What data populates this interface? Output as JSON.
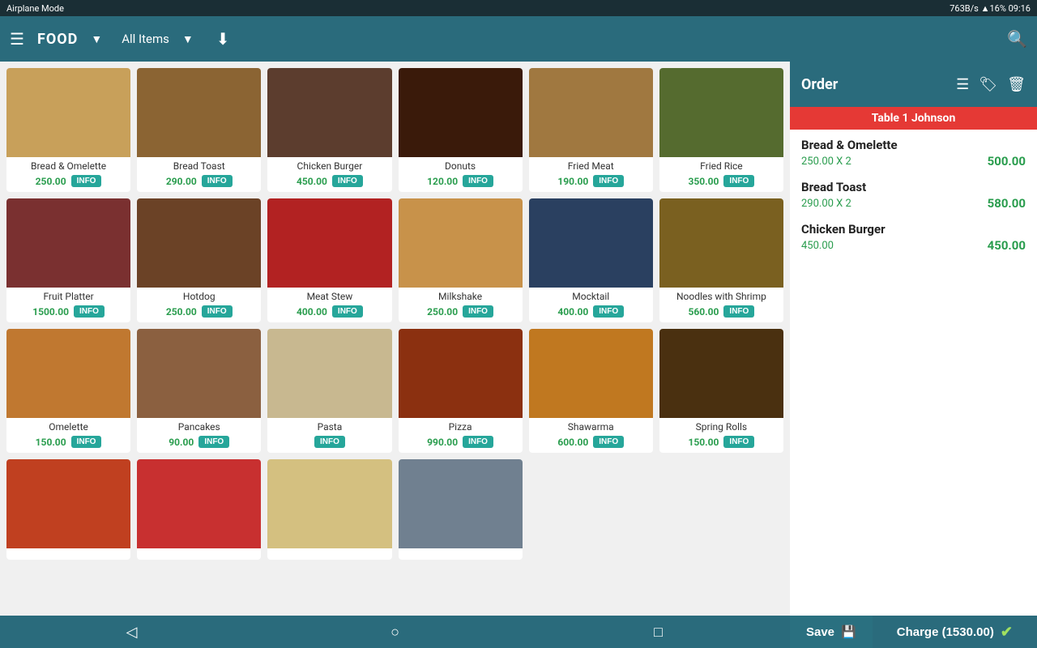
{
  "statusBar": {
    "left": "Airplane Mode",
    "right": "763B/s  ▲16%  09:16"
  },
  "topNav": {
    "menuIcon": "☰",
    "title": "FOOD",
    "dropdownIcon": "▼",
    "category": "All Items",
    "categoryDropIcon": "▼",
    "inboxIcon": "⬇",
    "searchIcon": "🔍"
  },
  "foodItems": [
    {
      "name": "Bread & Omelette",
      "price": "250.00",
      "color": "#c8a05a",
      "id": "bread-omelette"
    },
    {
      "name": "Bread Toast",
      "price": "290.00",
      "color": "#8b6433",
      "id": "bread-toast"
    },
    {
      "name": "Chicken Burger",
      "price": "450.00",
      "color": "#5c3d2e",
      "id": "chicken-burger"
    },
    {
      "name": "Donuts",
      "price": "120.00",
      "color": "#3a1a0a",
      "id": "donuts"
    },
    {
      "name": "Fried Meat",
      "price": "190.00",
      "color": "#a07840",
      "id": "fried-meat"
    },
    {
      "name": "Fried Rice",
      "price": "350.00",
      "color": "#556b2f",
      "id": "fried-rice"
    },
    {
      "name": "Fruit Platter",
      "price": "1500.00",
      "color": "#7a3030",
      "id": "fruit-platter"
    },
    {
      "name": "Hotdog",
      "price": "250.00",
      "color": "#6b4226",
      "id": "hotdog"
    },
    {
      "name": "Meat Stew",
      "price": "400.00",
      "color": "#b22222",
      "id": "meat-stew"
    },
    {
      "name": "Milkshake",
      "price": "250.00",
      "color": "#c8924a",
      "id": "milkshake"
    },
    {
      "name": "Mocktail",
      "price": "400.00",
      "color": "#2a4060",
      "id": "mocktail"
    },
    {
      "name": "Noodles with Shrimp",
      "price": "560.00",
      "color": "#7a6020",
      "id": "noodles-shrimp"
    },
    {
      "name": "Omelette",
      "price": "150.00",
      "color": "#c07830",
      "id": "omelette"
    },
    {
      "name": "Pancakes",
      "price": "90.00",
      "color": "#8b6040",
      "id": "pancakes"
    },
    {
      "name": "Pasta",
      "price": "",
      "color": "#c8b890",
      "id": "pasta"
    },
    {
      "name": "Pizza",
      "price": "990.00",
      "color": "#8b3010",
      "id": "pizza"
    },
    {
      "name": "Shawarma",
      "price": "600.00",
      "color": "#c07820",
      "id": "shawarma"
    },
    {
      "name": "Spring Rolls",
      "price": "150.00",
      "color": "#4a3010",
      "id": "spring-rolls"
    }
  ],
  "order": {
    "title": "Order",
    "tableName": "Table 1  Johnson",
    "items": [
      {
        "name": "Bread & Omelette",
        "price": "250.00",
        "qty": "X 2",
        "total": "500.00"
      },
      {
        "name": "Bread Toast",
        "price": "290.00",
        "qty": "X 2",
        "total": "580.00"
      },
      {
        "name": "Chicken Burger",
        "price": "450.00",
        "qty": "",
        "total": "450.00"
      }
    ],
    "saveLabel": "Save",
    "chargeLabel": "Charge (1530.00)",
    "saveIcon": "💾",
    "chargeIcon": "✔"
  },
  "bottomNav": {
    "backIcon": "◁",
    "homeIcon": "○",
    "squareIcon": "□"
  }
}
